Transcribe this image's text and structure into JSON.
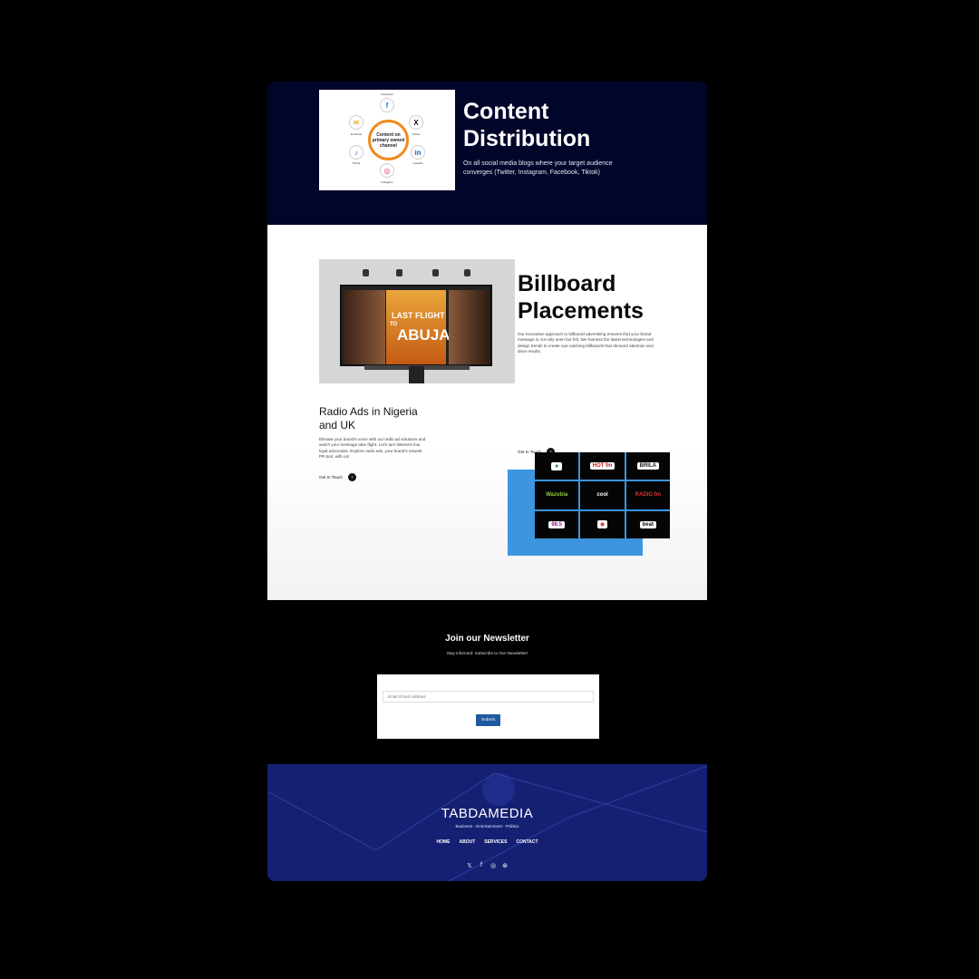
{
  "distribution": {
    "title": "Content Distribution",
    "body": "On all social media blogs where your target audience converges (Twitter, Instagram, Facebook, Tiktok)",
    "diagram": {
      "center": "Content on primary owned channel",
      "nodes": [
        {
          "label": "Facebook",
          "glyph": "f"
        },
        {
          "label": "Twitter",
          "glyph": "X"
        },
        {
          "label": "LinkedIn",
          "glyph": "in"
        },
        {
          "label": "Instagram",
          "glyph": "◎"
        },
        {
          "label": "TikTok",
          "glyph": "♪"
        },
        {
          "label": "Email list",
          "glyph": "✉"
        }
      ]
    }
  },
  "billboard": {
    "title": "Billboard Placements",
    "body": "Our innovative approach to billboard advertising ensures that your brand message is not only seen but felt. We harness the latest technologies and design trends to create eye-catching billboards that demand attention and drive results.",
    "cta": "Get In Touch",
    "poster": {
      "line1": "LAST FLIGHT",
      "line2": "TO",
      "line3": "ABUJA"
    }
  },
  "radio": {
    "title": "Radio Ads in Nigeria and UK",
    "body": "Elevate your brand's voice with our radio ad solutions and watch your message take flight. Let's turn listeners into loyal advocates. Explore radio ads, your brand's newest PR tool, with us!",
    "cta": "Get In Touch",
    "logos": [
      {
        "text": "★",
        "bg": "#ffffff",
        "fg": "#2a6f2a"
      },
      {
        "text": "HOT fm",
        "bg": "#ffffff",
        "fg": "#d01818"
      },
      {
        "text": "BRILA",
        "bg": "#ffffff",
        "fg": "#1a1a1a"
      },
      {
        "text": "Wazobia",
        "bg": "#050505",
        "fg": "#8fd13b"
      },
      {
        "text": "cool",
        "bg": "#050505",
        "fg": "#ffffff"
      },
      {
        "text": "RADIO fm",
        "bg": "#050505",
        "fg": "#e03030"
      },
      {
        "text": "98.5",
        "bg": "#ffffff",
        "fg": "#9b1c8a"
      },
      {
        "text": "◉",
        "bg": "#ffffff",
        "fg": "#c21d1d"
      },
      {
        "text": "beat",
        "bg": "#ffffff",
        "fg": "#111111"
      }
    ]
  },
  "newsletter": {
    "title": "Join our Newsletter",
    "subtitle": "Stay informed: Subscribe to Our Newsletter!",
    "placeholder": "Enter Email Address",
    "submit": "Submit"
  },
  "footer": {
    "brand": "TABDAMEDIA",
    "tagline": "Business - Entertainment - Politics",
    "nav": [
      "HOME",
      "ABOUT",
      "SERVICES",
      "CONTACT"
    ],
    "social": [
      {
        "name": "twitter-icon",
        "glyph": "𝕏"
      },
      {
        "name": "facebook-icon",
        "glyph": "f"
      },
      {
        "name": "instagram-icon",
        "glyph": "◎"
      },
      {
        "name": "dribbble-icon",
        "glyph": "⊛"
      }
    ]
  },
  "colors": {
    "navy": "#02052a",
    "footer": "#152072",
    "accent_blue": "#3c95de",
    "button": "#1f5a9e",
    "ring": "#f08a1e"
  }
}
